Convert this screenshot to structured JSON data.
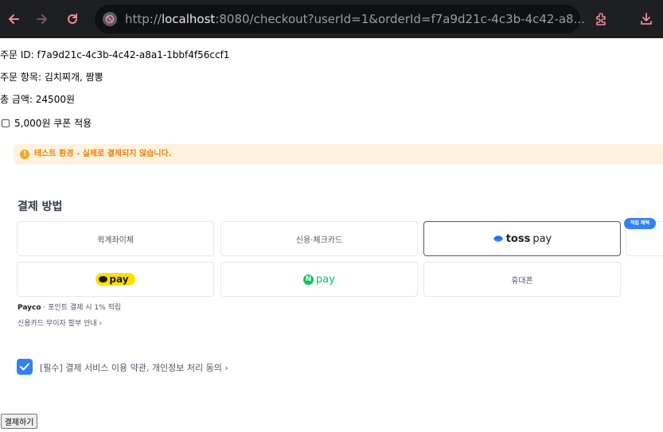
{
  "browser": {
    "url_scheme": "http://",
    "url_host": "localhost",
    "url_rest": ":8080/checkout?userId=1&orderId=f7a9d21c-4c3b-4c42-a8..."
  },
  "order": {
    "id_line": "주문 ID: f7a9d21c-4c3b-4c42-a8a1-1bbf4f56ccf1",
    "items_line": "주문 항목: 김치찌개, 짬뽕",
    "total_line": "총 금액: 24500원",
    "coupon_label": "5,000원 쿠폰 적용"
  },
  "notice": {
    "text": "테스트 환경 - 실제로 결제되지 않습니다."
  },
  "payment": {
    "title": "결제 방법",
    "methods": {
      "transfer": "퀵계좌이체",
      "card": "신용·체크카드",
      "toss_brand": "toss",
      "toss_pay": "pay",
      "kakao_pay": "pay",
      "naver_n": "N",
      "naver_pay": "pay",
      "phone": "휴대폰"
    },
    "badge": "적립 혜택",
    "payco_brand": "Payco",
    "payco_text": " · 포인트 결제 시 1% 적립",
    "installment_link": "신용카드 무이자 할부 안내 ›"
  },
  "agreement": {
    "text": "[필수] 결제 서비스 이용 약관, 개인정보 처리 동의 ›"
  },
  "pay_button": "결제하기",
  "colors": {
    "accent": "#3182f6",
    "kakao": "#ffe000",
    "naver": "#03c75a",
    "nav_icon": "#f28a9b",
    "notice_bg": "#fff3e0",
    "notice_text": "#e8830c"
  }
}
